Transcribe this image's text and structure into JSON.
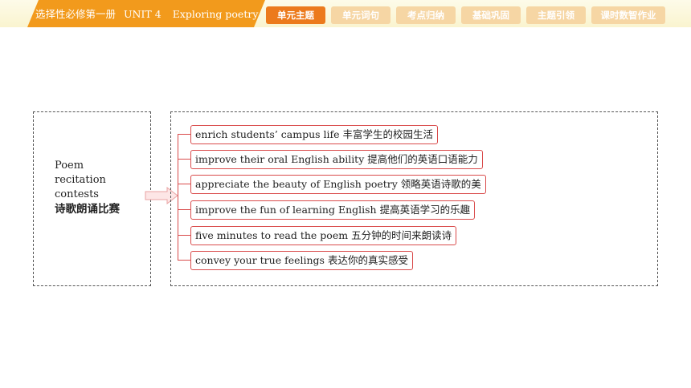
{
  "header": {
    "book": "选择性必修第一册",
    "unit": "UNIT 4",
    "topic": "Exploring poetry",
    "tabs": [
      {
        "label": "单元主题",
        "active": true
      },
      {
        "label": "单元词句",
        "active": false
      },
      {
        "label": "考点归纳",
        "active": false
      },
      {
        "label": "基础巩固",
        "active": false
      },
      {
        "label": "主题引领",
        "active": false
      },
      {
        "label": "课时数智作业",
        "active": false
      }
    ]
  },
  "left": {
    "line1": "Poem",
    "line2": "recitation",
    "line3": "contests",
    "cn": "诗歌朗诵比赛"
  },
  "items": [
    {
      "en": "enrich students’ campus life ",
      "cn": "丰富学生的校园生活"
    },
    {
      "en": "improve their oral English ability ",
      "cn": "提高他们的英语口语能力"
    },
    {
      "en": "appreciate the beauty of English poetry ",
      "cn": "领略英语诗歌的美"
    },
    {
      "en": "improve the fun of learning English ",
      "cn": "提高英语学习的乐趣"
    },
    {
      "en": "five minutes to read the poem ",
      "cn": "五分钟的时间来朗读诗"
    },
    {
      "en": "convey your true feelings ",
      "cn": "表达你的真实感受"
    }
  ],
  "colors": {
    "accent_orange": "#ec7a1c",
    "tab_inactive": "#f6d6a4",
    "banner": "#f29a1c",
    "item_border": "#d94b4b"
  }
}
